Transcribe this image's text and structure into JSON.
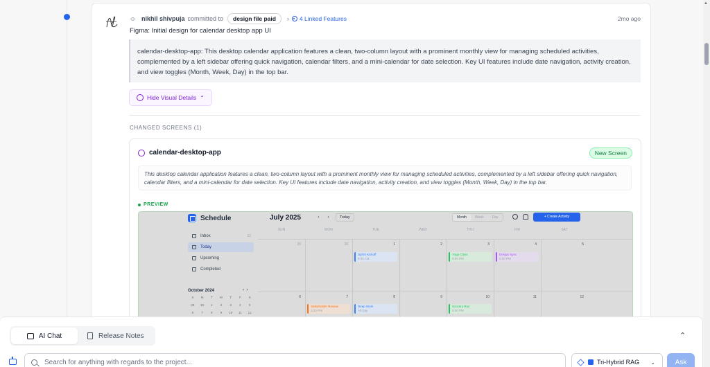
{
  "commit": {
    "author": "nikhil shivpuja",
    "action": "committed to",
    "branch": "design file paid",
    "linked_features": "4 Linked Features",
    "time_ago": "2mo ago",
    "message": "Figma: Initial design for calendar desktop app UI",
    "description": "calendar-desktop-app: This desktop calendar application features a clean, two-column layout with a prominent monthly view for managing scheduled activities, complemented by a left sidebar offering quick navigation, calendar filters, and a mini-calendar for date selection. Key UI features include date navigation, activity creation, and view toggles (Month, Week, Day) in the top bar.",
    "hide_visual_label": "Hide Visual Details"
  },
  "changed_screens": {
    "label": "CHANGED SCREENS (1)",
    "screen_name": "calendar-desktop-app",
    "badge": "New Screen",
    "description": "This desktop calendar application features a clean, two-column layout with a prominent monthly view for managing scheduled activities, complemented by a left sidebar offering quick navigation, calendar filters, and a mini-calendar for date selection. Key UI features include date navigation, activity creation, and view toggles (Month, Week, Day) in the top bar.",
    "preview_label": "PREVIEW"
  },
  "preview": {
    "app_name": "Schedule",
    "nav": [
      {
        "label": "Inbox",
        "count": "12"
      },
      {
        "label": "Today",
        "count": ""
      },
      {
        "label": "Upcoming",
        "count": ""
      },
      {
        "label": "Completed",
        "count": ""
      }
    ],
    "mini_month": "October 2024",
    "mini_prev": "‹",
    "mini_next": "›",
    "mini_days": [
      "S",
      "M",
      "T",
      "W",
      "T",
      "F",
      "S",
      "29",
      "30",
      "1",
      "2",
      "3",
      "4",
      "5",
      "6",
      "7",
      "8",
      "9",
      "10",
      "11",
      "12"
    ],
    "month_title": "July 2025",
    "prev": "‹",
    "next": "›",
    "today": "Today",
    "views": [
      "Month",
      "Week",
      "Day"
    ],
    "create": "+ Create Activity",
    "weekdays": [
      "SUN",
      "MON",
      "TUE",
      "WED",
      "THU",
      "FRI",
      "SAT"
    ],
    "week1": [
      "29",
      "30",
      "1",
      "2",
      "3",
      "4",
      "5"
    ],
    "week2": [
      "6",
      "7",
      "8",
      "9",
      "10",
      "11",
      "12"
    ],
    "events": [
      {
        "title": "Sprint Kickoff",
        "time": "9:00 AM",
        "color": "#3b82f6",
        "bg": "#dbe4f3"
      },
      {
        "title": "Yoga Class",
        "time": "6:00 PM",
        "color": "#22c55e",
        "bg": "#d8eadb"
      },
      {
        "title": "Design Sync",
        "time": "2:00 PM",
        "color": "#a855f7",
        "bg": "#e4dcec"
      },
      {
        "title": "Stakeholder Review",
        "time": "3:00 PM",
        "color": "#f97316",
        "bg": "#eedfd2"
      },
      {
        "title": "Deep Work",
        "time": "All Day",
        "color": "#3b82f6",
        "bg": "#dbe4f3"
      },
      {
        "title": "Grocery Run",
        "time": "5:00 PM",
        "color": "#22c55e",
        "bg": "#d8eadb"
      }
    ]
  },
  "bottom": {
    "tabs": [
      "AI Chat",
      "Release Notes"
    ],
    "search_placeholder": "Search for anything with regards to the project...",
    "rag_mode": "Tri-Hybrid RAG",
    "ask": "Ask"
  },
  "icons": [
    "commit-icon",
    "link-icon",
    "palette-icon",
    "chevron-up-icon",
    "chat-icon",
    "document-icon",
    "search-icon",
    "bot-icon",
    "layers-icon",
    "chevron-down-icon"
  ]
}
